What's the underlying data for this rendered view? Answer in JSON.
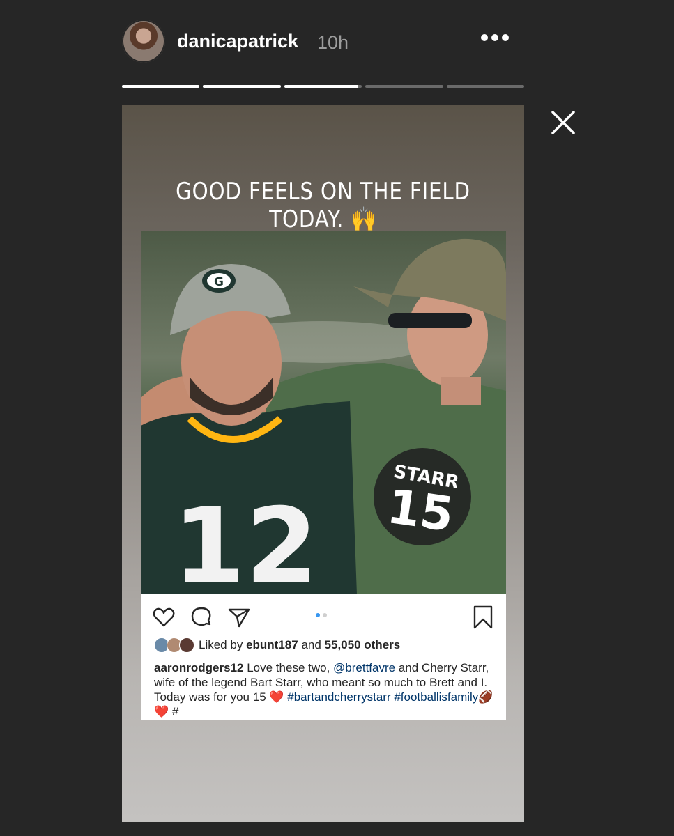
{
  "header": {
    "username": "danicapatrick",
    "time": "10h"
  },
  "progress": [
    1,
    1,
    0.95,
    0,
    0
  ],
  "story": {
    "headline": "GOOD FEELS ON THE FIELD TODAY. 🙌"
  },
  "post": {
    "likes": {
      "prefix": "Liked by",
      "user": "ebunt187",
      "middle": "and",
      "count": "55,050 others"
    },
    "caption": {
      "author": "aaronrodgers12",
      "text1": " Love these two, ",
      "mention": "@brettfavre",
      "text2": " and Cherry Starr, wife of the legend Bart Starr, who meant so much to Brett and I. Today was for you 15 ❤️ ",
      "hashtag1": "#bartandcherrystarr",
      "hashtag2": "#footballisfamily",
      "tail": "🏈❤️ #"
    },
    "photo": {
      "jersey_left": "12",
      "shirt_right_name": "STARR",
      "shirt_right_number": "15"
    }
  },
  "colors": {
    "background": "#262626",
    "packers_green": "#203731",
    "packers_gold": "#ffb612",
    "link": "#003569",
    "active_dot": "#3897f0"
  },
  "icons": [
    "more-icon",
    "close-icon",
    "heart-icon",
    "comment-icon",
    "share-icon",
    "bookmark-icon"
  ]
}
